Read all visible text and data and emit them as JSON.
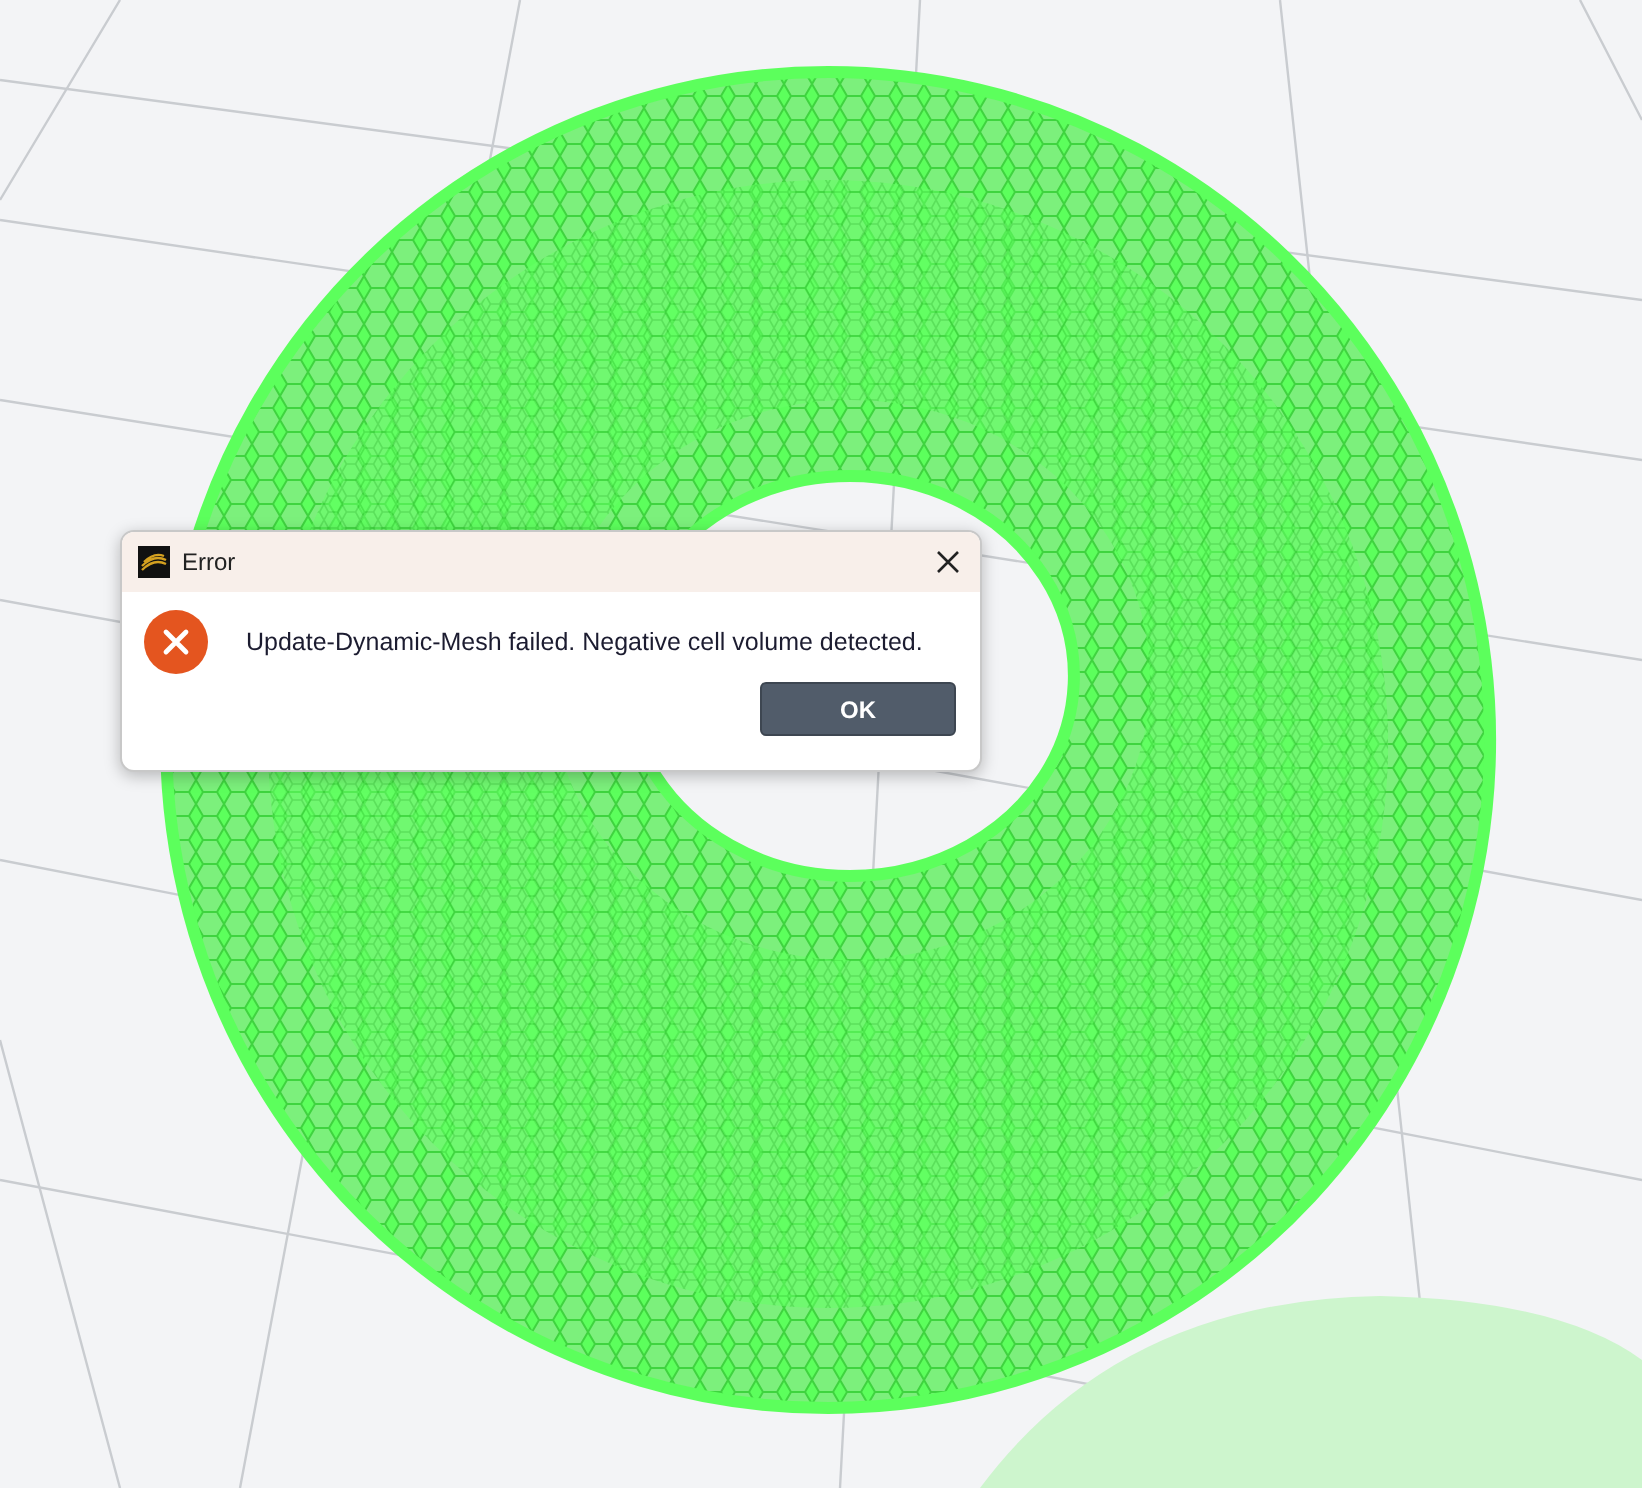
{
  "dialog": {
    "title": "Error",
    "message": "Update-Dynamic-Mesh failed. Negative cell volume detected.",
    "buttons": [
      "OK"
    ]
  }
}
